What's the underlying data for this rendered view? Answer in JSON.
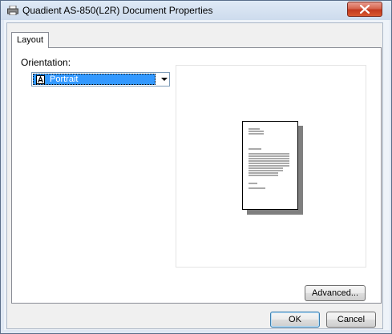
{
  "window": {
    "title": "Quadient AS-850(L2R) Document Properties",
    "title_icon": "printer-icon",
    "close_icon": "close-icon"
  },
  "tabs": [
    {
      "label": "Layout",
      "selected": true
    }
  ],
  "layout": {
    "orientation_label": "Orientation:",
    "orientation_value": "Portrait",
    "orientation_icon": "portrait-page-icon",
    "advanced_button": "Advanced..."
  },
  "buttons": {
    "ok": "OK",
    "cancel": "Cancel"
  },
  "colors": {
    "selection": "#3399ff",
    "close_button": "#c2391f"
  }
}
